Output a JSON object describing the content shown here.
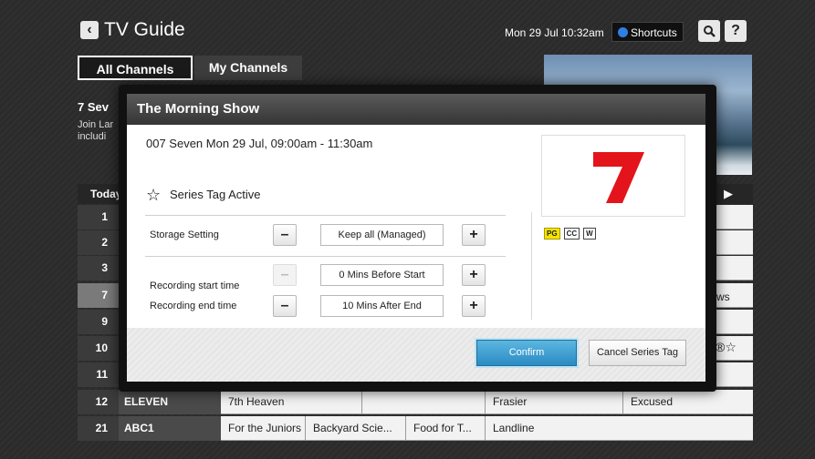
{
  "header": {
    "back_icon": "chevron-left-icon",
    "title": "TV Guide",
    "datetime": "Mon 29 Jul 10:32am",
    "shortcuts_label": "Shortcuts",
    "shortcuts_dot_color": "#2f7fe3",
    "search_icon": "search-icon",
    "help_icon": "help-icon"
  },
  "tabs": [
    {
      "label": "All Channels",
      "active": true
    },
    {
      "label": "My Channels",
      "active": false
    }
  ],
  "left_info": {
    "title": "7 Sev",
    "desc_line1": "Join Lar",
    "desc_line2": "includi"
  },
  "grid": {
    "today_label": "Today",
    "next_icon": "play-right-icon",
    "rows": [
      {
        "num": "1",
        "name": "",
        "programs": []
      },
      {
        "num": "2",
        "name": "",
        "programs": []
      },
      {
        "num": "3",
        "name": "",
        "programs": []
      },
      {
        "num": "7",
        "name": "",
        "programs": [],
        "selected": true
      },
      {
        "num": "9",
        "name": "",
        "programs": []
      },
      {
        "num": "10",
        "name": "",
        "programs": []
      },
      {
        "num": "11",
        "name": "",
        "programs": []
      },
      {
        "num": "12",
        "name": "ELEVEN",
        "programs": [
          "7th Heaven",
          "",
          "Frasier",
          "Excused"
        ]
      },
      {
        "num": "21",
        "name": "ABC1",
        "programs": [
          "For the Juniors",
          "Backyard Scie...",
          "Food for T...",
          "Landline"
        ]
      }
    ],
    "right_visible_text": "ws",
    "right_icons_text": "®☆"
  },
  "modal": {
    "title": "The Morning Show",
    "info": "007 Seven  Mon 29 Jul, 09:00am - 11:30am",
    "series_tag_icon": "star-tag-icon",
    "series_tag_label": "Series Tag Active",
    "storage_label": "Storage Setting",
    "storage_value": "Keep all (Managed)",
    "start_label": "Recording start time",
    "start_value": "0 Mins Before Start",
    "end_label": "Recording end time",
    "end_value": "10 Mins After End",
    "minus": "–",
    "plus": "+",
    "ratings": [
      "PG",
      "CC",
      "W"
    ],
    "logo_color": "#e3141b",
    "confirm_label": "Confirm",
    "cancel_label": "Cancel Series Tag"
  }
}
